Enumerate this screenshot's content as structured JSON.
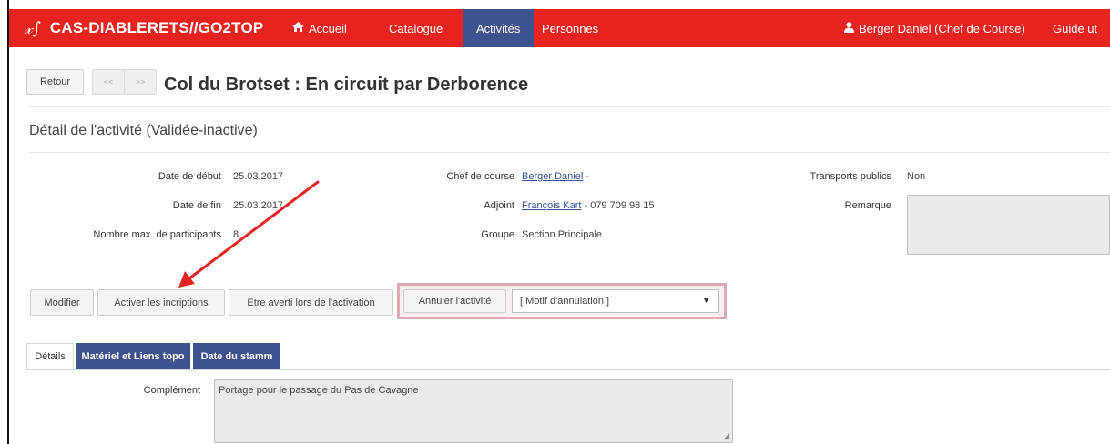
{
  "navbar": {
    "brand_logo": "𝓍∫",
    "brand": "CAS-DIABLERETS//GO2TOP",
    "home_label": "Accueil",
    "catalogue_label": "Catalogue",
    "activites_label": "Activités",
    "personnes_label": "Personnes",
    "user_label": "Berger Daniel (Chef de Course)",
    "guide_label": "Guide ut",
    "color_bg": "#e8231f",
    "color_active": "#3f5290"
  },
  "header": {
    "back_label": "Retour",
    "prev_label": "<<",
    "next_label": ">>",
    "title": "Col du Brotset : En circuit par Derborence",
    "subtitle": "Détail de l'activité  (Validée-inactive)"
  },
  "details": {
    "start_date_label": "Date de début",
    "start_date": "25.03.2017",
    "end_date_label": "Date de fin",
    "end_date": "25.03.2017",
    "max_participants_label": "Nombre max. de participants",
    "max_participants": "8",
    "leader_label": "Chef de course",
    "leader_name": "Berger Daniel",
    "leader_suffix": " -",
    "deputy_label": "Adjoint",
    "deputy_name": "François Kart",
    "deputy_suffix": " - 079 709 98 15",
    "group_label": "Groupe",
    "group": "Section Principale",
    "transport_label": "Transports publics",
    "transport": "Non",
    "remark_label": "Remarque",
    "remark": ""
  },
  "actions": {
    "modify_label": "Modifier",
    "activate_label": "Activer les incriptions",
    "notify_label": "Etre averti lors de l'activation",
    "cancel_label": "Annuler l'activité",
    "reason_selected": "[ Motif d'annulation ]"
  },
  "tabs": {
    "details": "Détails",
    "material": "Matériel et Liens topo",
    "stamm": "Date du stamm"
  },
  "content": {
    "complement_label": "Complément",
    "complement": "Portage pour  le passage du Pas de Cavagne"
  },
  "annotation": {
    "arrow_color": "#e8231f"
  }
}
